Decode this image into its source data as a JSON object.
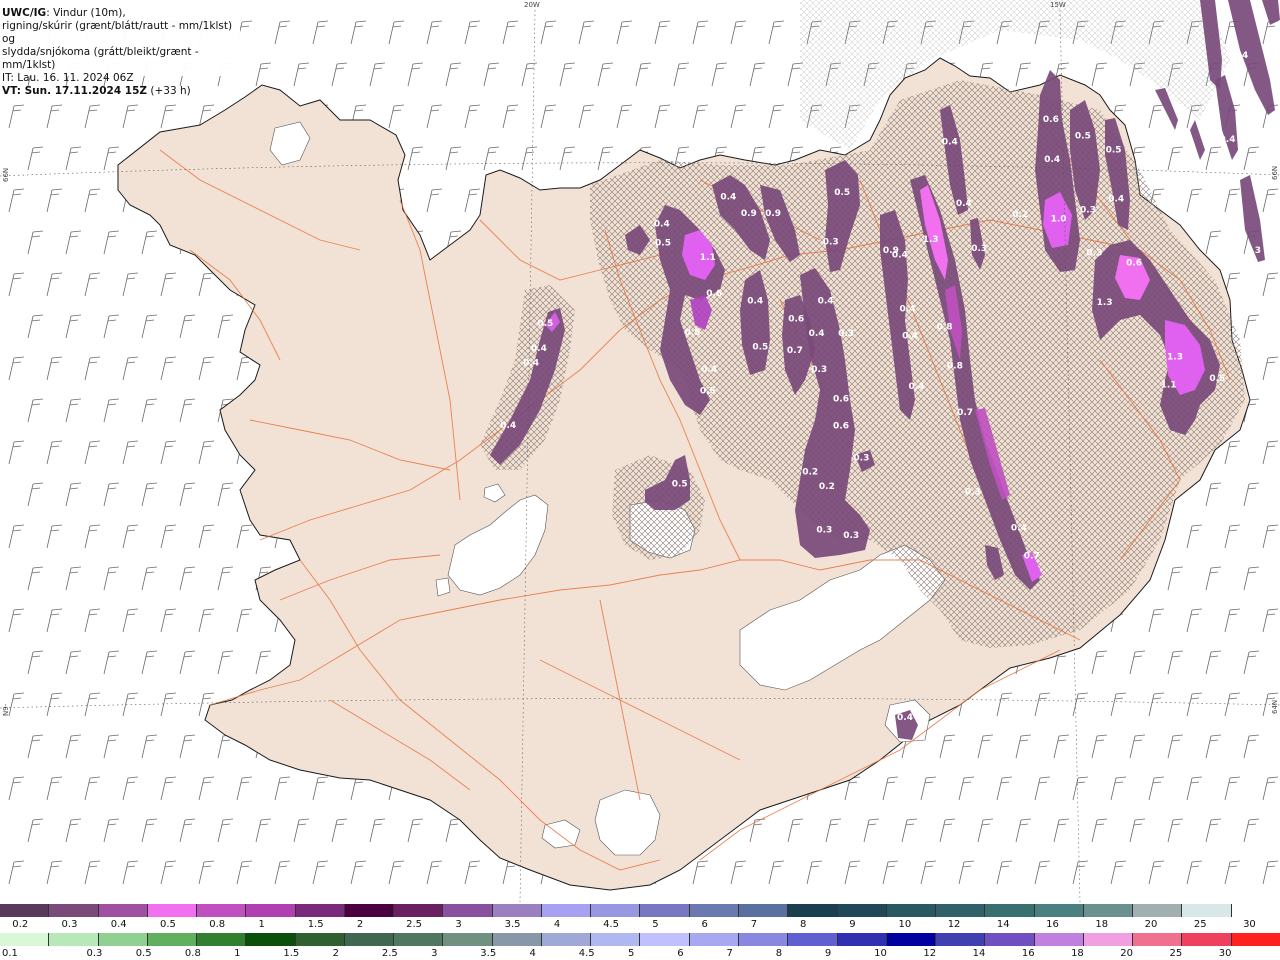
{
  "header": {
    "title_bold": "UWC/IG",
    "title_rest": ": Vindur (10m),",
    "line2": "rigning/skúrir (grænt/blátt/rautt - mm/1klst) og",
    "line3": "slydda/snjókoma (grátt/bleikt/grænt - mm/1klst)",
    "issue_time": "IT: Lau. 16. 11. 2024 06Z",
    "valid_time_label": "VT: Sun. 17.11.2024 15Z",
    "lead_time": "(+33 h)"
  },
  "coords": {
    "top_left": "20W",
    "top_right": "15W",
    "left_upper": "66N",
    "left_lower": "N9-",
    "right_upper": "66N",
    "right_lower": "64N"
  },
  "precip_labels": [
    {
      "text": "0.4",
      "col": 0.517,
      "row": 0.248
    },
    {
      "text": "0.5",
      "col": 0.518,
      "row": 0.269
    },
    {
      "text": "0.4",
      "col": 0.703,
      "row": 0.282
    },
    {
      "text": "1.1",
      "col": 0.553,
      "row": 0.285
    },
    {
      "text": "0.9",
      "col": 0.585,
      "row": 0.236
    },
    {
      "text": "0.4",
      "col": 0.569,
      "row": 0.218
    },
    {
      "text": "0.9",
      "col": 0.604,
      "row": 0.236
    },
    {
      "text": "0.5",
      "col": 0.658,
      "row": 0.213
    },
    {
      "text": "0.3",
      "col": 0.649,
      "row": 0.268
    },
    {
      "text": "0.9",
      "col": 0.696,
      "row": 0.277
    },
    {
      "text": "1.3",
      "col": 0.727,
      "row": 0.265
    },
    {
      "text": "0.6",
      "col": 0.558,
      "row": 0.325
    },
    {
      "text": "0.4",
      "col": 0.59,
      "row": 0.333
    },
    {
      "text": "0.4",
      "col": 0.645,
      "row": 0.333
    },
    {
      "text": "0.5",
      "col": 0.541,
      "row": 0.368
    },
    {
      "text": "0.5",
      "col": 0.426,
      "row": 0.358
    },
    {
      "text": "0.4",
      "col": 0.421,
      "row": 0.386
    },
    {
      "text": "0.4",
      "col": 0.415,
      "row": 0.402
    },
    {
      "text": "0.4",
      "col": 0.397,
      "row": 0.471
    },
    {
      "text": "0.6",
      "col": 0.622,
      "row": 0.353
    },
    {
      "text": "0.4",
      "col": 0.638,
      "row": 0.369
    },
    {
      "text": "0.3",
      "col": 0.661,
      "row": 0.369
    },
    {
      "text": "0.7",
      "col": 0.621,
      "row": 0.388
    },
    {
      "text": "0.5",
      "col": 0.594,
      "row": 0.384
    },
    {
      "text": "0.3",
      "col": 0.64,
      "row": 0.409
    },
    {
      "text": "0.4",
      "col": 0.554,
      "row": 0.409
    },
    {
      "text": "0.5",
      "col": 0.553,
      "row": 0.433
    },
    {
      "text": "0.4",
      "col": 0.709,
      "row": 0.342
    },
    {
      "text": "0.4",
      "col": 0.711,
      "row": 0.372
    },
    {
      "text": "0.8",
      "col": 0.738,
      "row": 0.362
    },
    {
      "text": "0.8",
      "col": 0.746,
      "row": 0.405
    },
    {
      "text": "0.4",
      "col": 0.716,
      "row": 0.428
    },
    {
      "text": "0.6",
      "col": 0.657,
      "row": 0.442
    },
    {
      "text": "0.6",
      "col": 0.657,
      "row": 0.472
    },
    {
      "text": "0.7",
      "col": 0.754,
      "row": 0.457
    },
    {
      "text": "0.3",
      "col": 0.673,
      "row": 0.507
    },
    {
      "text": "0.2",
      "col": 0.633,
      "row": 0.523
    },
    {
      "text": "0.2",
      "col": 0.646,
      "row": 0.539
    },
    {
      "text": "0.5",
      "col": 0.531,
      "row": 0.536
    },
    {
      "text": "0.3",
      "col": 0.644,
      "row": 0.587
    },
    {
      "text": "0.3",
      "col": 0.665,
      "row": 0.593
    },
    {
      "text": "0.3",
      "col": 0.76,
      "row": 0.545
    },
    {
      "text": "0.4",
      "col": 0.796,
      "row": 0.585
    },
    {
      "text": "0.7",
      "col": 0.806,
      "row": 0.616
    },
    {
      "text": "0.5",
      "col": 0.846,
      "row": 0.15
    },
    {
      "text": "0.6",
      "col": 0.821,
      "row": 0.132
    },
    {
      "text": "0.4",
      "col": 0.822,
      "row": 0.176
    },
    {
      "text": "0.5",
      "col": 0.87,
      "row": 0.166
    },
    {
      "text": "1.0",
      "col": 0.827,
      "row": 0.242
    },
    {
      "text": "0.3",
      "col": 0.85,
      "row": 0.232
    },
    {
      "text": "0.4",
      "col": 0.872,
      "row": 0.22
    },
    {
      "text": "0.2",
      "col": 0.797,
      "row": 0.237
    },
    {
      "text": "0.4",
      "col": 0.742,
      "row": 0.157
    },
    {
      "text": "0.4",
      "col": 0.753,
      "row": 0.225
    },
    {
      "text": "0.3",
      "col": 0.765,
      "row": 0.275
    },
    {
      "text": "0.6",
      "col": 0.886,
      "row": 0.291
    },
    {
      "text": "1.3",
      "col": 0.863,
      "row": 0.335
    },
    {
      "text": "1.3",
      "col": 0.918,
      "row": 0.395
    },
    {
      "text": "1.1",
      "col": 0.913,
      "row": 0.426
    },
    {
      "text": "0.5",
      "col": 0.951,
      "row": 0.419
    },
    {
      "text": "0.3",
      "col": 0.855,
      "row": 0.28
    },
    {
      "text": "0.4",
      "col": 0.707,
      "row": 0.795
    },
    {
      "text": "0.4",
      "col": 0.969,
      "row": 0.061
    },
    {
      "text": "0.3",
      "col": 0.979,
      "row": 0.277
    },
    {
      "text": "0.3",
      "col": 0.979,
      "row": 0.303
    },
    {
      "text": "0.4",
      "col": 0.959,
      "row": 0.154
    }
  ],
  "legend": {
    "snow_colors": [
      "#5a3a5a",
      "#7a4a7a",
      "#a050a0",
      "#f070f0",
      "#c050c0",
      "#b040b0",
      "#7a2a7a",
      "#4b0040",
      "#6a2060",
      "#8a50a0",
      "#9a80c0",
      "#a8a0f0",
      "#9898e0",
      "#7878c0",
      "#6a7ab0",
      "#5a70a0",
      "#1a4050",
      "#204858",
      "#285860",
      "#306068",
      "#387070",
      "#4a8080",
      "#6a9090",
      "#a0b0b0",
      "#d8e8e8",
      "#ffffff"
    ],
    "snow_labels": [
      "0.2",
      "0.3",
      "0.4",
      "0.5",
      "0.8",
      "1",
      "1.5",
      "2",
      "2.5",
      "3",
      "3.5",
      "4",
      "4.5",
      "5",
      "6",
      "7",
      "8",
      "9",
      "10",
      "12",
      "14",
      "16",
      "18",
      "20",
      "25",
      "30"
    ],
    "rain_colors": [
      "#d8f8d8",
      "#b8e8b8",
      "#90d090",
      "#60b060",
      "#308030",
      "#0a500a",
      "#306030",
      "#406850",
      "#507860",
      "#709080",
      "#8898a8",
      "#a0a8d8",
      "#b0b8f0",
      "#c0c0ff",
      "#a8a8f0",
      "#8888e0",
      "#6060d0",
      "#3030b0",
      "#0000a0",
      "#4040b0",
      "#7050c0",
      "#c080e0",
      "#f0a0e0",
      "#f07090",
      "#f04060",
      "#ff2020"
    ],
    "rain_labels": [
      "0.1",
      "0.3",
      "0.5",
      "0.8",
      "1",
      "1.5",
      "2",
      "2.5",
      "3",
      "3.5",
      "4",
      "4.5",
      "5",
      "6",
      "7",
      "8",
      "9",
      "10",
      "12",
      "14",
      "16",
      "18",
      "20",
      "25",
      "30"
    ]
  }
}
